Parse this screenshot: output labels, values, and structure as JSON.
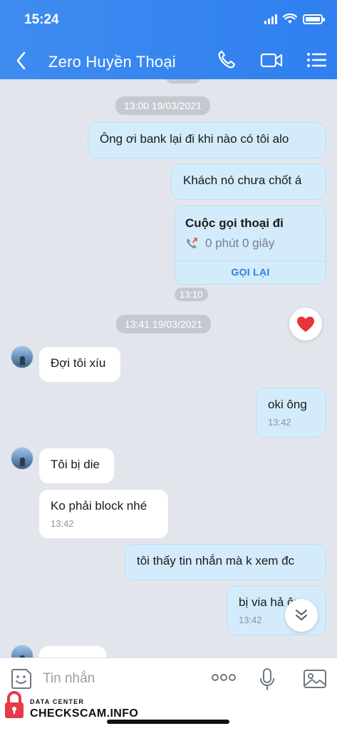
{
  "status_bar": {
    "time": "15:24"
  },
  "header": {
    "title": "Zero Huyền Thoại"
  },
  "messages": {
    "ts1": "13:00 19/03/2021",
    "m1": "Ông ơi bank lại đi khi nào có tôi alo",
    "m2": "Khách nó chưa chốt á",
    "call": {
      "title": "Cuộc gọi thoại đi",
      "duration": "0 phút 0 giây",
      "action": "GỌI LẠI"
    },
    "ts_small": "13:10",
    "ts2": "13:41 19/03/2021",
    "m3": "Đợi tôi xíu",
    "m4": "oki ông",
    "m4_time": "13:42",
    "m5": "Tôi bị die",
    "m6": "Ko phải block nhé",
    "m6_time": "13:42",
    "m7": "tôi thấy tin nhắn mà k xem đc",
    "m8": "bị via hả ông",
    "m8_time": "13:42"
  },
  "input": {
    "placeholder": "Tin nhắn"
  },
  "watermark": {
    "top": "DATA CENTER",
    "main": "CHECKSCAM.INFO"
  },
  "colors": {
    "header": "#3088f0",
    "outgoing": "#d4ebfb",
    "incoming": "#ffffff",
    "accent": "#2b7fe0"
  }
}
